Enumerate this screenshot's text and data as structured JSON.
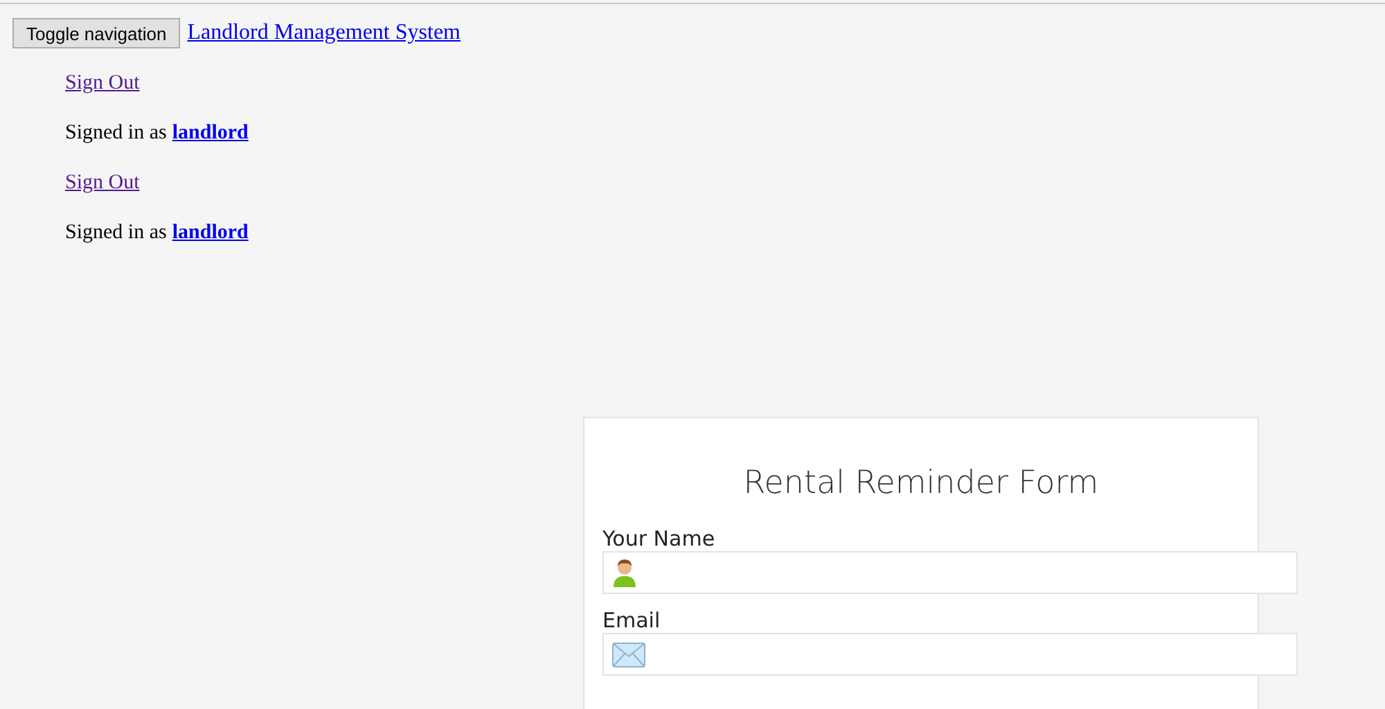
{
  "navbar": {
    "toggle_button": "Toggle navigation",
    "brand": "Landlord Management System"
  },
  "nav_items": [
    {
      "kind": "link",
      "label": "Sign Out",
      "visited": true
    },
    {
      "kind": "status",
      "text": "Signed in as",
      "user": "landlord",
      "visited": false
    },
    {
      "kind": "link",
      "label": "Sign Out",
      "visited": true
    },
    {
      "kind": "status",
      "text": "Signed in as",
      "user": "landlord",
      "visited": false
    }
  ],
  "form": {
    "title": "Rental Reminder Form",
    "fields": [
      {
        "kind": "name",
        "label": "Your Name"
      },
      {
        "kind": "email",
        "label": "Email"
      }
    ]
  }
}
